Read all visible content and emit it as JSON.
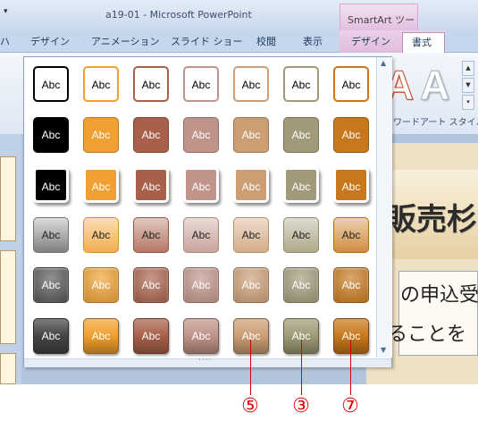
{
  "window": {
    "title": "a19-01 - Microsoft PowerPoint",
    "contextual_tab_group": "SmartArt ツール",
    "quick_access_glyph": "▾"
  },
  "tabs": {
    "partial": "ハ",
    "design": "デザイン",
    "animations": "アニメーション",
    "slideshow": "スライド ショー",
    "review": "校閲",
    "view": "表示",
    "smartart_design": "デザイン",
    "smartart_format": "書式"
  },
  "ribbon": {
    "wordart_letter": "A",
    "wordart_group_label": "ワードアート スタイル",
    "scroll_up": "▲",
    "scroll_down": "▼",
    "more": "▾"
  },
  "gallery": {
    "swatch_label": "Abc",
    "scroll_up": "▲",
    "scroll_down": "▼",
    "grip": "····",
    "rows": [
      [
        "outline-black",
        "outline-orange",
        "outline-brown",
        "outline-rose",
        "outline-tan",
        "outline-olive",
        "outline-amber"
      ],
      [
        "fill-black",
        "fill-orange",
        "fill-brown",
        "fill-rose",
        "fill-tan",
        "fill-olive",
        "fill-amber"
      ],
      [
        "shadow-black",
        "shadow-orange",
        "shadow-brown",
        "shadow-rose",
        "shadow-tan",
        "shadow-olive",
        "shadow-amber"
      ],
      [
        "soft-gray",
        "soft-peach",
        "soft-salmon",
        "soft-pink",
        "soft-apricot",
        "soft-khaki",
        "soft-coral"
      ],
      [
        "glow-dark",
        "glow-orange",
        "glow-brick",
        "glow-mauve",
        "glow-tan",
        "glow-olive",
        "glow-orange2"
      ],
      [
        "gloss-dark",
        "gloss-orange",
        "gloss-brick",
        "gloss-mauve",
        "gloss-tan",
        "gloss-olive",
        "gloss-orange2"
      ]
    ],
    "colors": {
      "black": "#000000",
      "orange": "#f0a030",
      "brown": "#a8604a",
      "rose": "#c0948a",
      "tan": "#cc9e74",
      "olive": "#a09a78",
      "amber": "#c8781c"
    }
  },
  "slide": {
    "heading": "販売杉",
    "line1": "の申込受",
    "line2": "ることを"
  },
  "callouts": [
    {
      "label": "⑤"
    },
    {
      "label": "③"
    },
    {
      "label": "⑦"
    }
  ]
}
